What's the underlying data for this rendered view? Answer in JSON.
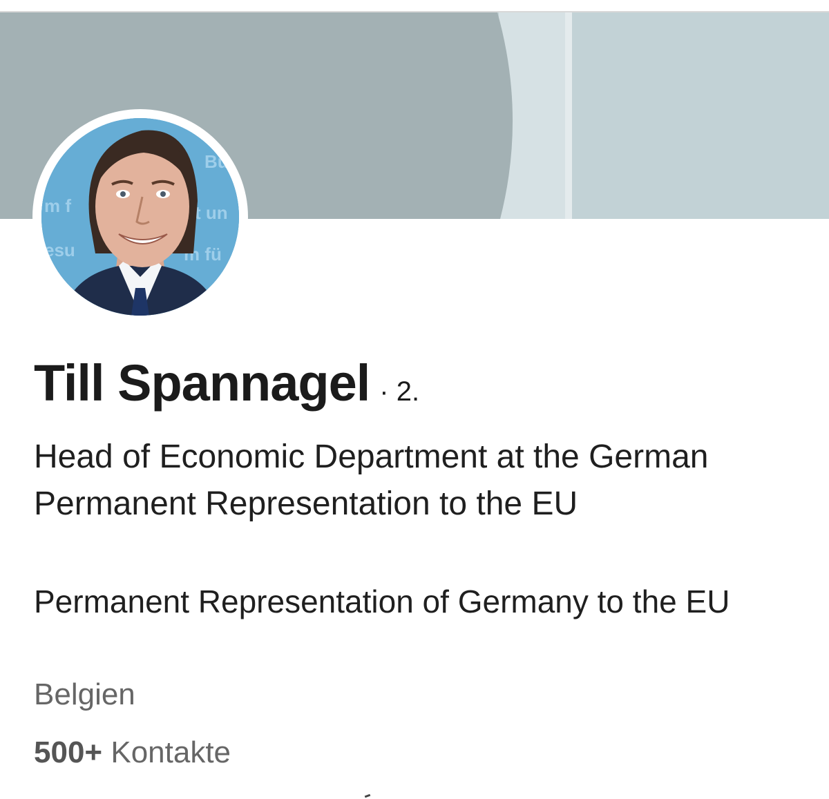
{
  "profile": {
    "name": "Till Spannagel",
    "degree": "· 2.",
    "headline": "Head of Economic Department at the German Permanent Representation to the EU",
    "company": "Permanent Representation of Germany to the EU",
    "location": "Belgien",
    "connections": {
      "count": "500+",
      "label": "Kontakte"
    }
  },
  "avatar": {
    "background_text": [
      "Bu",
      "m f",
      "t un",
      "esu",
      "m fü"
    ]
  },
  "colors": {
    "cover_left": "#a3b1b4",
    "cover_mid": "#d6e1e4",
    "cover_right": "#c2d2d6",
    "avatar_bg": "#5aa6cf",
    "name_text": "#1b1b1b",
    "secondary_text": "#666666"
  }
}
